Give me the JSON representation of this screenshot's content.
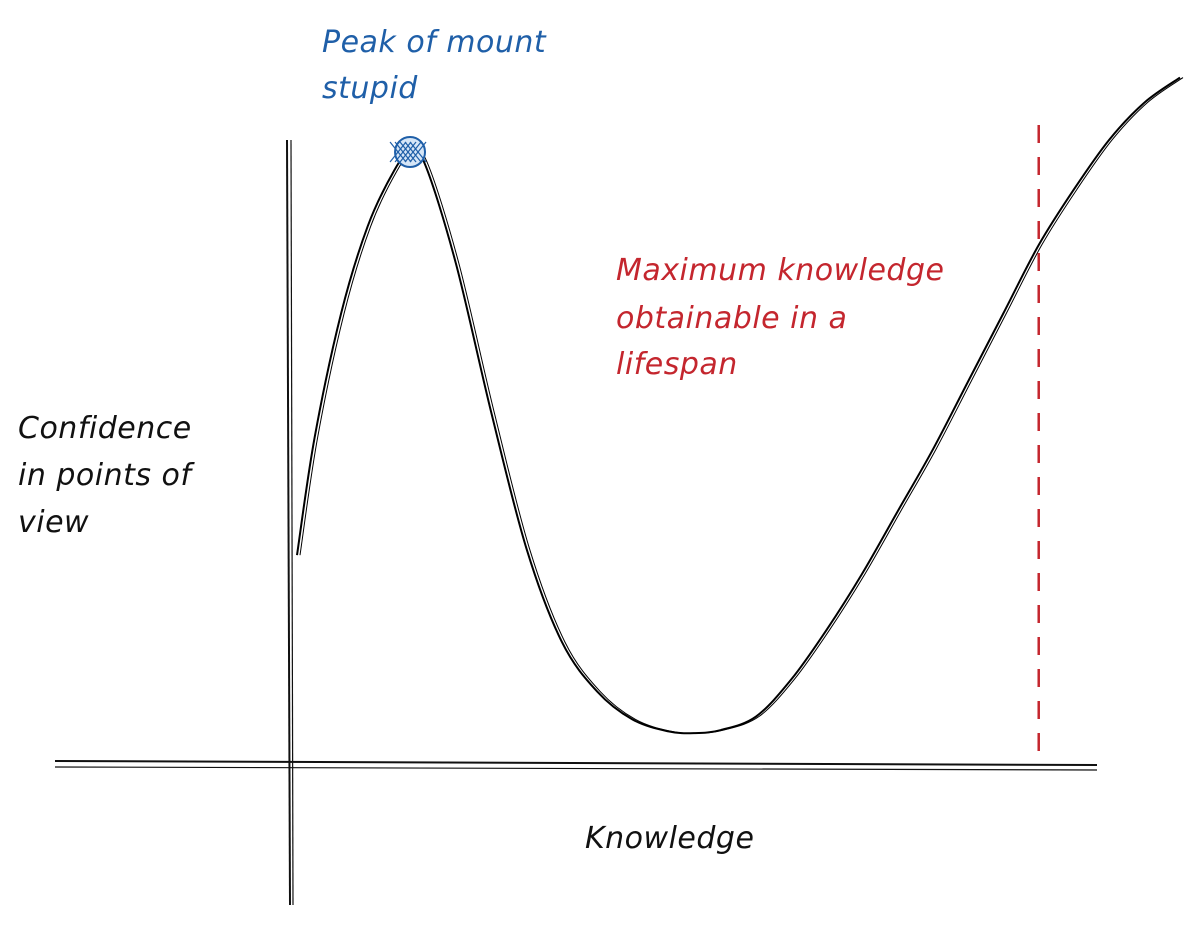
{
  "chart_data": {
    "type": "line",
    "title": "",
    "xlabel": "Knowledge",
    "ylabel_lines": [
      "Confidence",
      "in points of",
      "view"
    ],
    "xlim": [
      0,
      100
    ],
    "ylim": [
      0,
      100
    ],
    "grid": false,
    "legend": "none",
    "series": [
      {
        "color": "#000000",
        "x": [
          0,
          2,
          5,
          8,
          11,
          12.8,
          14.5,
          18,
          22,
          26,
          30,
          34,
          38,
          42,
          45,
          48,
          52,
          56,
          60,
          64,
          68,
          72,
          76,
          80,
          84,
          88,
          92,
          96,
          100
        ],
        "y": [
          29,
          48,
          68,
          82,
          91,
          94,
          92,
          76,
          52,
          30,
          15,
          7,
          2.5,
          0.6,
          0.3,
          0.8,
          3,
          9,
          17,
          26,
          36,
          46,
          57,
          68,
          79,
          88,
          96,
          102,
          106
        ]
      }
    ],
    "annotations": [
      {
        "name": "peak-of-mount-stupid",
        "lines": [
          "Peak of mount",
          "stupid"
        ],
        "color": "#1f5fa8",
        "x": 12.8,
        "y": 94
      },
      {
        "name": "max-knowledge-lifespan",
        "lines": [
          "Maximum knowledge",
          "obtainable in a",
          "lifespan"
        ],
        "color": "#c4262e",
        "x": 84,
        "style": "dashed-vertical-line"
      }
    ]
  }
}
